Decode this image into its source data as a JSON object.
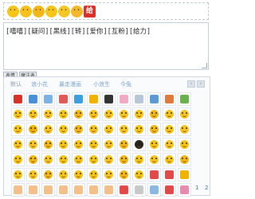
{
  "toolbar": {
    "buttons": [
      {
        "icon": "smiley-face-icon",
        "color": "#f5c518"
      },
      {
        "icon": "grinning-face-icon",
        "color": "#f7c21b"
      },
      {
        "icon": "cool-face-icon",
        "color": "#f2b81a"
      },
      {
        "icon": "wink-face-icon",
        "color": "#f5c518"
      },
      {
        "icon": "laughing-face-icon",
        "color": "#f6c625"
      },
      {
        "icon": "shy-face-icon",
        "color": "#f3b82c"
      }
    ],
    "gift": {
      "icon": "gift-icon",
      "label": "给",
      "color": "#d9312a"
    }
  },
  "editor": {
    "content": "[嘻嘻][疑问][黑线][转][爱你][互粉][给力]"
  },
  "mini_tabs": [
    "表情",
    "魔法表情"
  ],
  "panel": {
    "tabs": [
      "默认",
      "浪小花",
      "暴走漫画",
      "小浪生",
      "今兔"
    ],
    "active_tab": 0,
    "prev_label": "‹",
    "next_label": "›",
    "pages": [
      "1",
      "2"
    ]
  },
  "emoji_rows": [
    [
      {
        "kind": "obj",
        "color": "#d9312a"
      },
      {
        "kind": "obj",
        "color": "#4a90d9"
      },
      {
        "kind": "obj",
        "color": "#7bb3e8"
      },
      {
        "kind": "obj",
        "color": "#e05a5a"
      },
      {
        "kind": "obj",
        "color": "#3aa0e0"
      },
      {
        "kind": "obj",
        "color": "#f0b400"
      },
      {
        "kind": "obj",
        "color": "#333333"
      },
      {
        "kind": "obj",
        "color": "#f3a9c2"
      },
      {
        "kind": "obj",
        "color": "#b7c7d8"
      },
      {
        "kind": "obj",
        "color": "#5b9bd5"
      },
      {
        "kind": "obj",
        "color": "#e07a3a"
      },
      {
        "kind": "obj",
        "color": "#6ab04c"
      }
    ],
    [
      {
        "kind": "face",
        "color": "#f5c518"
      },
      {
        "kind": "face",
        "color": "#f5c518"
      },
      {
        "kind": "face",
        "color": "#f6c625"
      },
      {
        "kind": "face",
        "color": "#f5c518"
      },
      {
        "kind": "face",
        "color": "#f2b81a"
      },
      {
        "kind": "face",
        "color": "#f7c21b"
      },
      {
        "kind": "face",
        "color": "#f5c518"
      },
      {
        "kind": "face",
        "color": "#f6c625"
      },
      {
        "kind": "face",
        "color": "#f5c518"
      },
      {
        "kind": "face",
        "color": "#f2b81a"
      },
      {
        "kind": "face",
        "color": "#f5c518"
      },
      {
        "kind": "face",
        "color": "#f6c625"
      }
    ],
    [
      {
        "kind": "face",
        "color": "#f5c518"
      },
      {
        "kind": "face",
        "color": "#f0b400"
      },
      {
        "kind": "face",
        "color": "#f6c625"
      },
      {
        "kind": "face",
        "color": "#f5c518"
      },
      {
        "kind": "face",
        "color": "#f2b81a"
      },
      {
        "kind": "face",
        "color": "#f7c21b"
      },
      {
        "kind": "face",
        "color": "#f5c518"
      },
      {
        "kind": "face",
        "color": "#f6c625"
      },
      {
        "kind": "face",
        "color": "#f5c518"
      },
      {
        "kind": "face",
        "color": "#f2b81a"
      },
      {
        "kind": "face",
        "color": "#f5c518"
      },
      {
        "kind": "face",
        "color": "#f6c625"
      }
    ],
    [
      {
        "kind": "face",
        "color": "#f5c518"
      },
      {
        "kind": "face",
        "color": "#f6c625"
      },
      {
        "kind": "face",
        "color": "#f2b81a"
      },
      {
        "kind": "face",
        "color": "#f5c518"
      },
      {
        "kind": "face",
        "color": "#f7c21b"
      },
      {
        "kind": "face",
        "color": "#f5c518"
      },
      {
        "kind": "face",
        "color": "#f6c625"
      },
      {
        "kind": "face",
        "color": "#f2b81a"
      },
      {
        "kind": "face",
        "color": "#222222"
      },
      {
        "kind": "face",
        "color": "#f5c518"
      },
      {
        "kind": "face",
        "color": "#f6c625"
      },
      {
        "kind": "face",
        "color": "#f5c518"
      }
    ],
    [
      {
        "kind": "face",
        "color": "#f5c518"
      },
      {
        "kind": "face",
        "color": "#f2b81a"
      },
      {
        "kind": "face",
        "color": "#f6c625"
      },
      {
        "kind": "face",
        "color": "#f5c518"
      },
      {
        "kind": "face",
        "color": "#f7c21b"
      },
      {
        "kind": "face",
        "color": "#f5c518"
      },
      {
        "kind": "face",
        "color": "#f6c625"
      },
      {
        "kind": "face",
        "color": "#f2b81a"
      },
      {
        "kind": "face",
        "color": "#f5c518"
      },
      {
        "kind": "face",
        "color": "#f6c625"
      },
      {
        "kind": "face",
        "color": "#f5c518"
      },
      {
        "kind": "face",
        "color": "#f2b81a"
      }
    ],
    [
      {
        "kind": "face",
        "color": "#f5c518"
      },
      {
        "kind": "face",
        "color": "#f6c625"
      },
      {
        "kind": "face",
        "color": "#f2b81a"
      },
      {
        "kind": "face",
        "color": "#f5c518"
      },
      {
        "kind": "face",
        "color": "#f7c21b"
      },
      {
        "kind": "face",
        "color": "#f5c518"
      },
      {
        "kind": "face",
        "color": "#f6c625"
      },
      {
        "kind": "face",
        "color": "#f2b81a"
      },
      {
        "kind": "face",
        "color": "#f5c518"
      },
      {
        "kind": "obj",
        "color": "#e24a4a"
      },
      {
        "kind": "obj",
        "color": "#e24a4a"
      },
      {
        "kind": "obj",
        "color": "#f0b400"
      }
    ],
    [
      {
        "kind": "obj",
        "color": "#f3c089"
      },
      {
        "kind": "obj",
        "color": "#f3c089"
      },
      {
        "kind": "obj",
        "color": "#f3c089"
      },
      {
        "kind": "obj",
        "color": "#f3c089"
      },
      {
        "kind": "obj",
        "color": "#f3c089"
      },
      {
        "kind": "obj",
        "color": "#f3c089"
      },
      {
        "kind": "obj",
        "color": "#f3c089"
      },
      {
        "kind": "obj",
        "color": "#e24a4a"
      },
      {
        "kind": "obj",
        "color": "#c9c9c9"
      },
      {
        "kind": "obj",
        "color": "#8bb8e0"
      },
      {
        "kind": "obj",
        "color": "#e24a4a"
      },
      {
        "kind": "obj",
        "color": "#e88ab0"
      }
    ]
  ]
}
